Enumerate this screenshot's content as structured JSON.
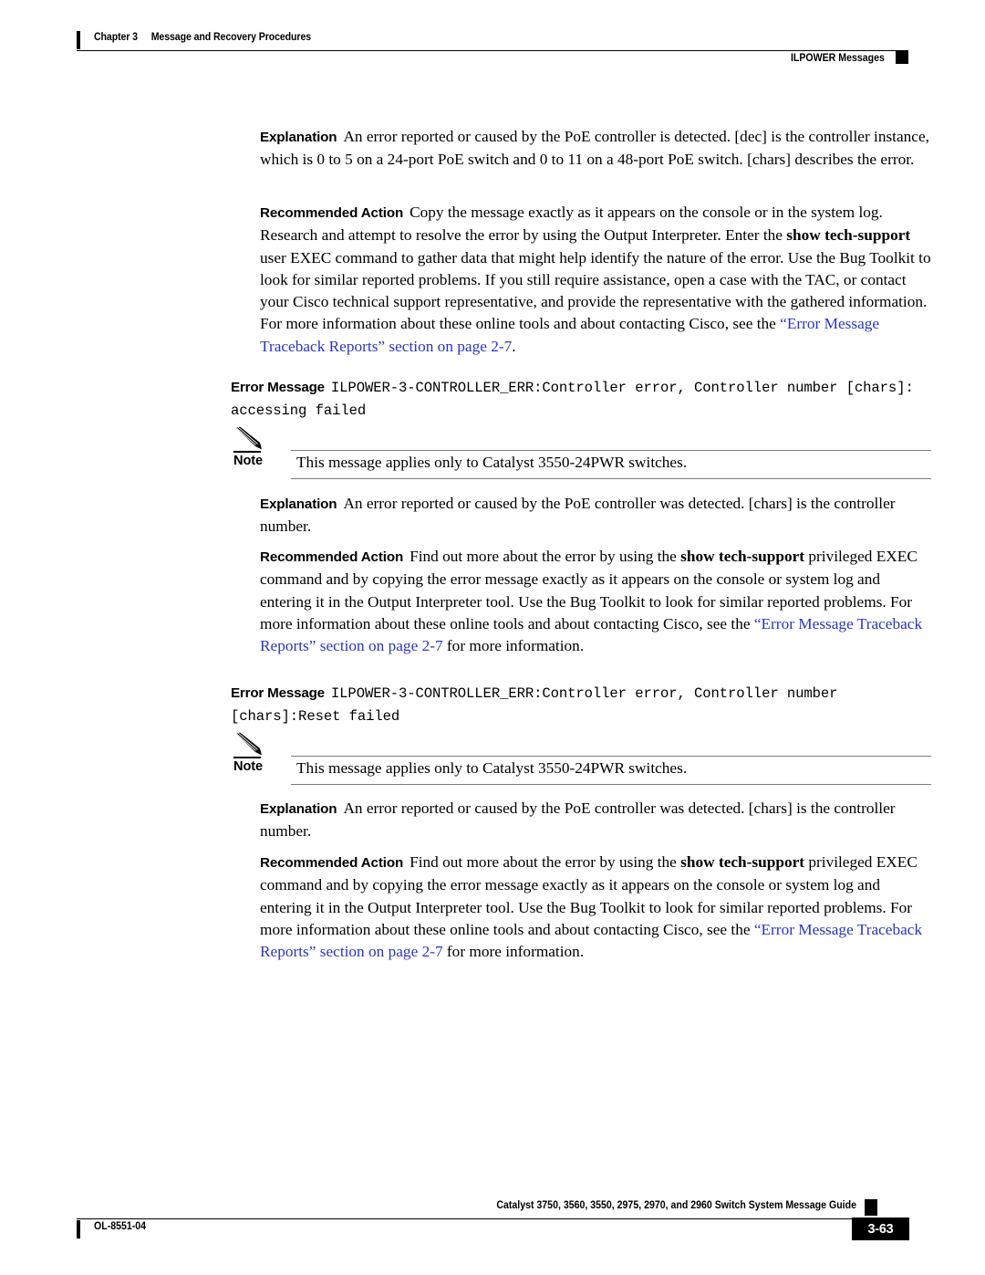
{
  "header": {
    "chapter_number": "Chapter 3",
    "chapter_title": "Message and Recovery Procedures",
    "section_title": "ILPOWER Messages"
  },
  "blocks": {
    "explanation_label": "Explanation",
    "recommended_action_label": "Recommended Action",
    "error_message_label": "Error Message",
    "note_label": "Note"
  },
  "explanation_1": {
    "text_before": "An error reported or caused by the PoE controller is detected. [dec] is the controller instance, which is 0 to 5 on a 24-port PoE switch and 0 to 11 on a 48-port PoE switch. [chars] describes the error."
  },
  "recommended_action_1": {
    "part1": "Copy the message exactly as it appears on the console or in the system log. Research and attempt to resolve the error by using the Output Interpreter. Enter the ",
    "bold1": "show tech-support",
    "part2": " user EXEC command to gather data that might help identify the nature of the error. Use the Bug Toolkit to look for similar reported problems. If you still require assistance, open a case with the TAC, or contact your Cisco technical support representative, and provide the representative with the gathered information. For more information about these online tools and about contacting Cisco, see the ",
    "link": "“Error Message Traceback Reports” section on page 2-7",
    "part3": "."
  },
  "error_message_1": {
    "code": "ILPOWER-3-CONTROLLER_ERR:Controller error, Controller number [chars]: accessing failed"
  },
  "note_1": {
    "text": "This message applies only to Catalyst 3550-24PWR switches."
  },
  "explanation_2": {
    "text": "An error reported or caused by the PoE controller was detected. [chars] is the controller number."
  },
  "recommended_action_2": {
    "part1": "Find out more about the error by using the ",
    "bold1": "show tech-support",
    "part2": " privileged EXEC command and by copying the error message exactly as it appears on the console or system log and entering it in the Output Interpreter tool. Use the Bug Toolkit to look for similar reported problems. For more information about these online tools and about contacting Cisco, see the ",
    "link": "“Error Message Traceback Reports” section on page 2-7",
    "part3": " for more information."
  },
  "error_message_2": {
    "code": "ILPOWER-3-CONTROLLER_ERR:Controller error, Controller number [chars]:Reset failed"
  },
  "note_2": {
    "text": "This message applies only to Catalyst 3550-24PWR switches."
  },
  "explanation_3": {
    "text": "An error reported or caused by the PoE controller was detected. [chars] is the controller number."
  },
  "recommended_action_3": {
    "part1": "Find out more about the error by using the ",
    "bold1": "show tech-support",
    "part2": " privileged EXEC command and by copying the error message exactly as it appears on the console or system log and entering it in the Output Interpreter tool. Use the Bug Toolkit to look for similar reported problems. For more information about these online tools and about contacting Cisco, see the ",
    "link": "“Error Message Traceback Reports” section on page 2-7",
    "part3": " for more information."
  },
  "footer": {
    "document_id": "OL-8551-04",
    "guide_title": "Catalyst 3750, 3560, 3550, 2975, 2970, and 2960 Switch System Message Guide",
    "page_number": "3-63"
  },
  "colors": {
    "link": "#2b35c4",
    "rule": "#000000",
    "note_rule": "#7b7b7b"
  }
}
